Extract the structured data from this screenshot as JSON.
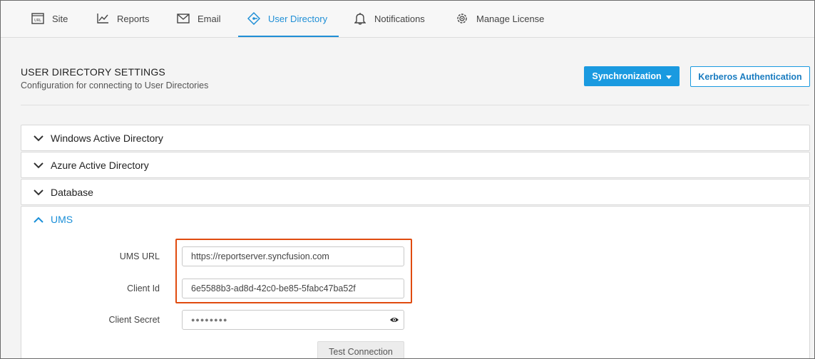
{
  "nav": {
    "tabs": [
      {
        "label": "Site",
        "icon": "url-document-icon"
      },
      {
        "label": "Reports",
        "icon": "line-chart-icon"
      },
      {
        "label": "Email",
        "icon": "envelope-icon"
      },
      {
        "label": "User Directory",
        "icon": "directory-icon",
        "active": true
      },
      {
        "label": "Notifications",
        "icon": "bell-icon"
      },
      {
        "label": "Manage License",
        "icon": "license-gear-icon"
      }
    ]
  },
  "header": {
    "title": "USER DIRECTORY SETTINGS",
    "subtitle": "Configuration for connecting to User Directories",
    "sync_label": "Synchronization",
    "kerberos_label": "Kerberos Authentication"
  },
  "accordion": {
    "items": [
      {
        "label": "Windows Active Directory",
        "expanded": false
      },
      {
        "label": "Azure Active Directory",
        "expanded": false
      },
      {
        "label": "Database",
        "expanded": false
      },
      {
        "label": "UMS",
        "expanded": true
      }
    ]
  },
  "ums_form": {
    "url_label": "UMS URL",
    "url_value": "https://reportserver.syncfusion.com",
    "client_id_label": "Client Id",
    "client_id_value": "6e5588b3-ad8d-42c0-be85-5fabc47ba52f",
    "client_secret_label": "Client Secret",
    "client_secret_value": "●●●●●●●●",
    "test_button": "Test Connection"
  },
  "colors": {
    "accent": "#1a9ae0",
    "active_tab": "#1f8fd6",
    "highlight": "#e04b0f"
  }
}
